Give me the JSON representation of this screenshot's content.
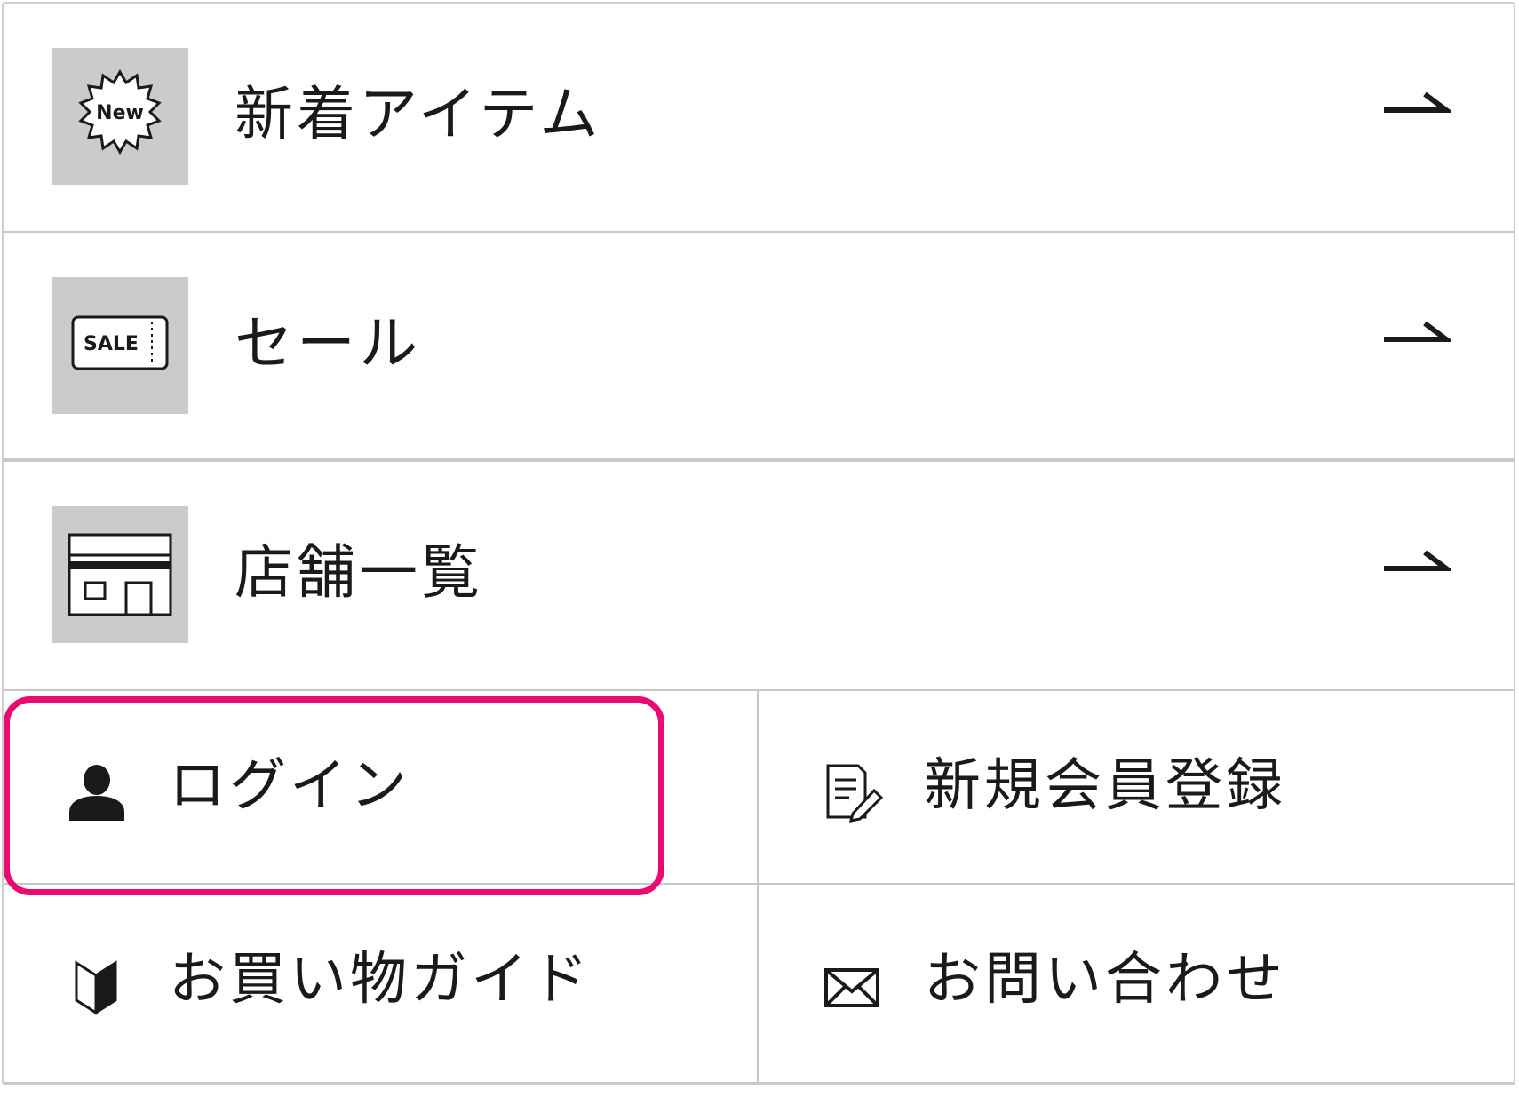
{
  "menu": {
    "rows": [
      {
        "label": "新着アイテム",
        "icon": "new-badge-icon",
        "icon_text": "New"
      },
      {
        "label": "セール",
        "icon": "sale-ticket-icon",
        "icon_text": "SALE"
      },
      {
        "label": "店舗一覧",
        "icon": "store-icon"
      }
    ],
    "links": [
      {
        "label": "ログイン",
        "icon": "user-icon"
      },
      {
        "label": "新規会員登録",
        "icon": "register-form-icon"
      },
      {
        "label": "お買い物ガイド",
        "icon": "beginner-mark-icon"
      },
      {
        "label": "お問い合わせ",
        "icon": "mail-icon"
      }
    ]
  },
  "colors": {
    "icon_box_bg": "#cbcbcb",
    "divider": "#c8c8c8",
    "highlight": "#ea0a72",
    "text": "#1a1a1a"
  }
}
